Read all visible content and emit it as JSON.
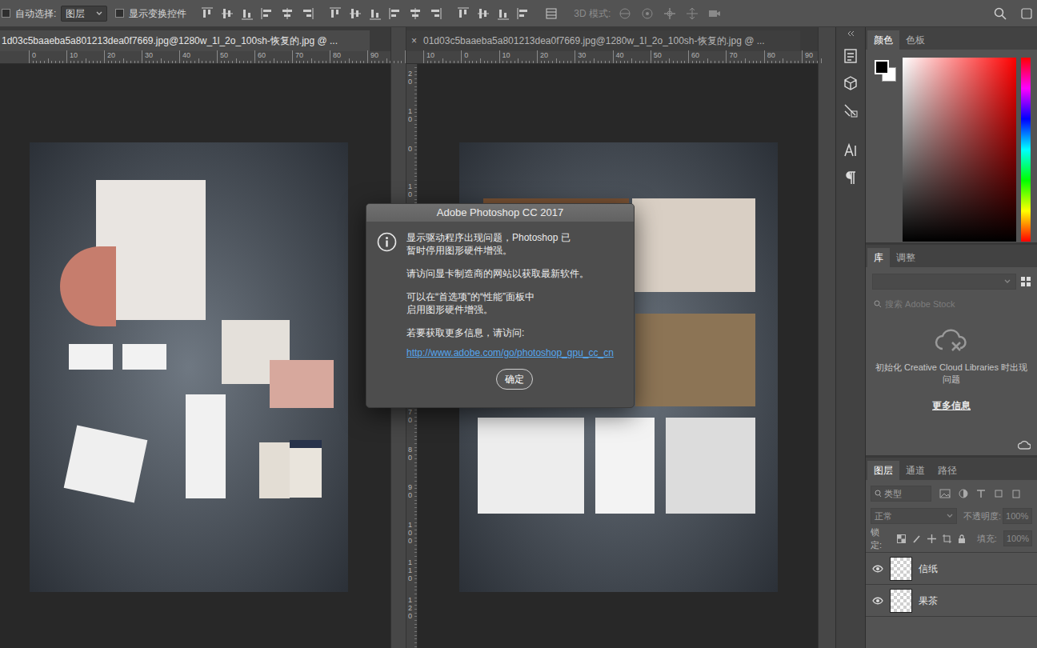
{
  "options_bar": {
    "auto_select": {
      "label": "自动选择:",
      "checked": false
    },
    "auto_select_target": "图层",
    "show_transform": {
      "label": "显示变换控件",
      "checked": false
    },
    "mode_3d_label": "3D 模式:"
  },
  "documents": [
    {
      "title": "1d03c5baaeba5a801213dea0f7669.jpg@1280w_1l_2o_100sh-恢复的.jpg @ ...",
      "selected": true
    },
    {
      "title": "01d03c5baaeba5a801213dea0f7669.jpg@1280w_1l_2o_100sh-恢复的.jpg @ ...",
      "selected": false,
      "close": "×"
    }
  ],
  "rulers": {
    "doc1_top": [
      "0",
      "10",
      "20",
      "30",
      "40",
      "50",
      "60",
      "70",
      "80",
      "90"
    ],
    "doc2_top": [
      "10",
      "0",
      "10",
      "20",
      "30",
      "40",
      "50",
      "60",
      "70",
      "80",
      "90"
    ],
    "doc2_side": [
      "20",
      "10",
      "0",
      "10",
      "70",
      "80",
      "90",
      "100",
      "110",
      "120"
    ]
  },
  "dialog": {
    "title": "Adobe Photoshop CC 2017",
    "paragraphs": [
      [
        "显示驱动程序出现问题，Photoshop 已",
        "暂时停用图形硬件增强。"
      ],
      [
        "请访问显卡制造商的网站以获取最新软件。"
      ],
      [
        "可以在“首选项”的“性能”面板中",
        "启用图形硬件增强。"
      ],
      [
        "若要获取更多信息，请访问:"
      ]
    ],
    "link": "http://www.adobe.com/go/photoshop_gpu_cc_cn",
    "button": "确定"
  },
  "color_panel": {
    "tabs": [
      {
        "label": "颜色",
        "selected": true
      },
      {
        "label": "色板",
        "selected": false
      }
    ]
  },
  "library_panel": {
    "tabs": [
      {
        "label": "库",
        "selected": true
      },
      {
        "label": "调整",
        "selected": false
      }
    ],
    "search": {
      "placeholder": "搜索 Adobe Stock"
    },
    "message": "初始化 Creative Cloud Libraries 时出现问题",
    "more_info": "更多信息"
  },
  "layers_panel": {
    "tabs": [
      {
        "label": "图层",
        "selected": true
      },
      {
        "label": "通道",
        "selected": false
      },
      {
        "label": "路径",
        "selected": false
      }
    ],
    "filter": "类型",
    "blend_mode": "正常",
    "opacity": {
      "label": "不透明度:",
      "value": "100%",
      "disabled": true
    },
    "lock_label": "锁定:",
    "fill": {
      "label": "填充:",
      "value": "100%",
      "disabled": true
    },
    "layers": [
      {
        "name": "信纸",
        "visible": true
      },
      {
        "name": "果茶",
        "visible": true
      }
    ]
  }
}
